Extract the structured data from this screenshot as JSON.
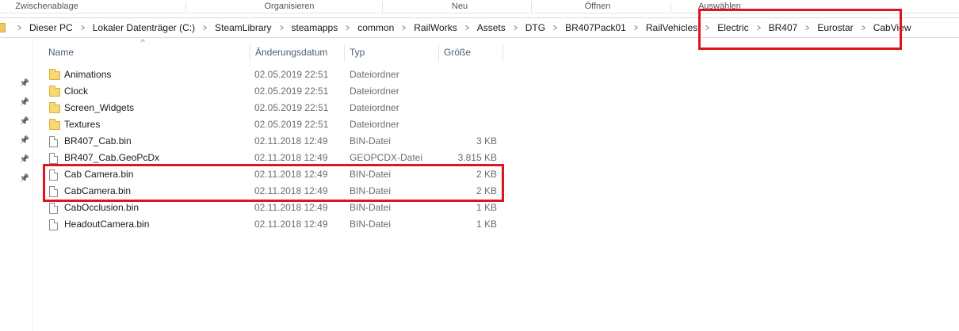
{
  "ribbon": {
    "groups": [
      "Zwischenablage",
      "Organisieren",
      "Neu",
      "Öffnen",
      "Auswählen"
    ]
  },
  "breadcrumb": {
    "items": [
      "Dieser PC",
      "Lokaler Datenträger (C:)",
      "SteamLibrary",
      "steamapps",
      "common",
      "RailWorks",
      "Assets",
      "DTG",
      "BR407Pack01",
      "RailVehicles",
      "Electric",
      "BR407",
      "Eurostar",
      "CabView"
    ]
  },
  "columns": {
    "name": "Name",
    "date": "Änderungsdatum",
    "type": "Typ",
    "size": "Größe"
  },
  "nav": {
    "pin_icon": "pin-icon",
    "pins": 6
  },
  "files": [
    {
      "name": "Animations",
      "date": "02.05.2019 22:51",
      "type": "Dateiordner",
      "size": "",
      "icon": "folder-icon"
    },
    {
      "name": "Clock",
      "date": "02.05.2019 22:51",
      "type": "Dateiordner",
      "size": "",
      "icon": "folder-icon"
    },
    {
      "name": "Screen_Widgets",
      "date": "02.05.2019 22:51",
      "type": "Dateiordner",
      "size": "",
      "icon": "folder-icon"
    },
    {
      "name": "Textures",
      "date": "02.05.2019 22:51",
      "type": "Dateiordner",
      "size": "",
      "icon": "folder-icon"
    },
    {
      "name": "BR407_Cab.bin",
      "date": "02.11.2018 12:49",
      "type": "BIN-Datei",
      "size": "3 KB",
      "icon": "file-icon"
    },
    {
      "name": "BR407_Cab.GeoPcDx",
      "date": "02.11.2018 12:49",
      "type": "GEOPCDX-Datei",
      "size": "3.815 KB",
      "icon": "file-icon"
    },
    {
      "name": "Cab Camera.bin",
      "date": "02.11.2018 12:49",
      "type": "BIN-Datei",
      "size": "2 KB",
      "icon": "file-icon"
    },
    {
      "name": "CabCamera.bin",
      "date": "02.11.2018 12:49",
      "type": "BIN-Datei",
      "size": "2 KB",
      "icon": "file-icon"
    },
    {
      "name": "CabOcclusion.bin",
      "date": "02.11.2018 12:49",
      "type": "BIN-Datei",
      "size": "1 KB",
      "icon": "file-icon"
    },
    {
      "name": "HeadoutCamera.bin",
      "date": "02.11.2018 12:49",
      "type": "BIN-Datei",
      "size": "1 KB",
      "icon": "file-icon"
    }
  ],
  "colors": {
    "highlight": "#e0141b",
    "folder": "#f8d775",
    "header_text": "#4c607a"
  }
}
